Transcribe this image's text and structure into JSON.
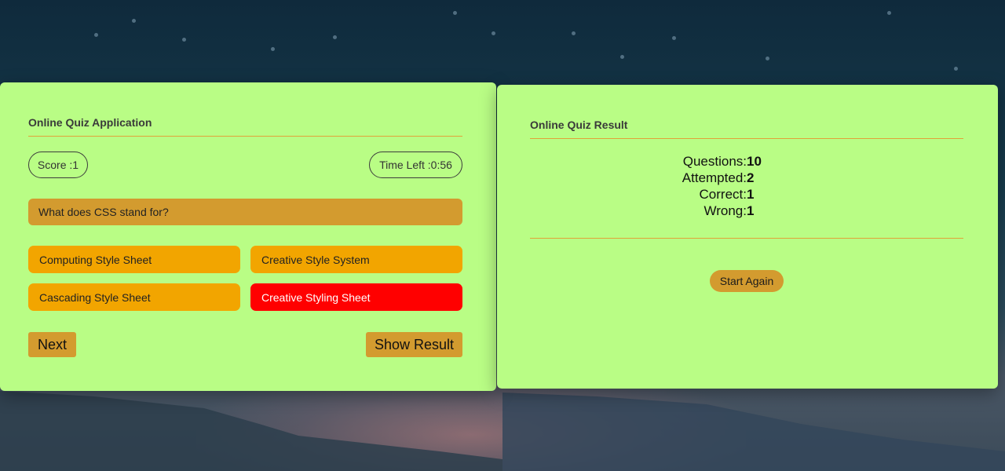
{
  "quiz": {
    "title": "Online Quiz Application",
    "score_label": "Score :1",
    "time_label": "Time Left :0:56",
    "question": "What does CSS stand for?",
    "options": [
      {
        "label": "Computing Style Sheet",
        "state": "default"
      },
      {
        "label": "Creative Style System",
        "state": "default"
      },
      {
        "label": "Cascading Style Sheet",
        "state": "default"
      },
      {
        "label": "Creative Styling Sheet",
        "state": "wrong"
      }
    ],
    "next_label": "Next",
    "show_result_label": "Show Result"
  },
  "result": {
    "title": "Online Quiz Result",
    "stats": [
      {
        "label": "Questions:",
        "value": "10"
      },
      {
        "label": "Attempted:",
        "value": "2"
      },
      {
        "label": "Correct:",
        "value": "1"
      },
      {
        "label": "Wrong:",
        "value": "1"
      }
    ],
    "start_again_label": "Start Again"
  },
  "colors": {
    "panel_bg": "#b9fd85",
    "accent_line": "#e0a33a",
    "option_bg": "#f2a500",
    "option_wrong_bg": "#ff0000",
    "button_bg": "#d39b2f"
  }
}
